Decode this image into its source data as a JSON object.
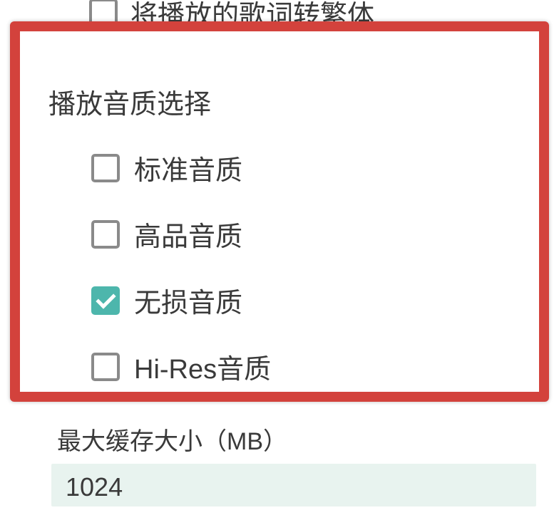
{
  "top_option": {
    "label": "将播放的歌词转繁体",
    "checked": false
  },
  "section": {
    "title": "播放音质选择",
    "options": [
      {
        "label": "标准音质",
        "checked": false
      },
      {
        "label": "高品音质",
        "checked": false
      },
      {
        "label": "无损音质",
        "checked": true
      },
      {
        "label": "Hi-Res音质",
        "checked": false
      }
    ]
  },
  "cache": {
    "label": "最大缓存大小（MB）",
    "value": "1024"
  },
  "colors": {
    "accent": "#4db6ac",
    "highlight_border": "#d3423c"
  }
}
